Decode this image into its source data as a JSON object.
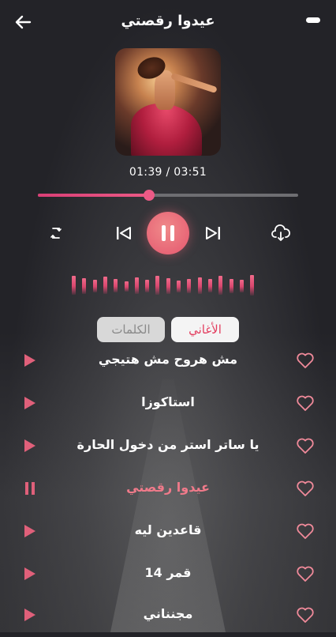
{
  "header": {
    "title": "عيدوا رقصتي",
    "back_icon": "arrow-left-icon",
    "menu_icon": "menu-pill-icon"
  },
  "player": {
    "time_label": "01:39 / 03:51",
    "progress": 0.428,
    "state": "playing"
  },
  "tabs": [
    {
      "label": "الأغاني",
      "active": true
    },
    {
      "label": "الكلمات",
      "active": false
    }
  ],
  "songs": [
    {
      "title": "مش هروح مش هتيجي",
      "playing": false
    },
    {
      "title": "استاكوزا",
      "playing": false
    },
    {
      "title": "يا ساتر استر من دخول الحارة",
      "playing": false
    },
    {
      "title": "عيدوا رقصتي",
      "playing": true
    },
    {
      "title": "قاعدين ليه",
      "playing": false
    },
    {
      "title": "قمر 14",
      "playing": false
    },
    {
      "title": "مجنناني",
      "playing": false
    }
  ],
  "colors": {
    "accent": "#e8577a",
    "active_song": "#f07a8a",
    "tab_active_text": "#e33d5e"
  },
  "visualizer_levels": [
    0.6,
    0.45,
    0.3,
    0.55,
    0.35,
    0.2,
    0.5,
    0.3,
    0.6,
    0.45,
    0.25,
    0.4,
    0.5,
    0.35,
    0.6,
    0.4,
    0.3,
    0.7
  ]
}
